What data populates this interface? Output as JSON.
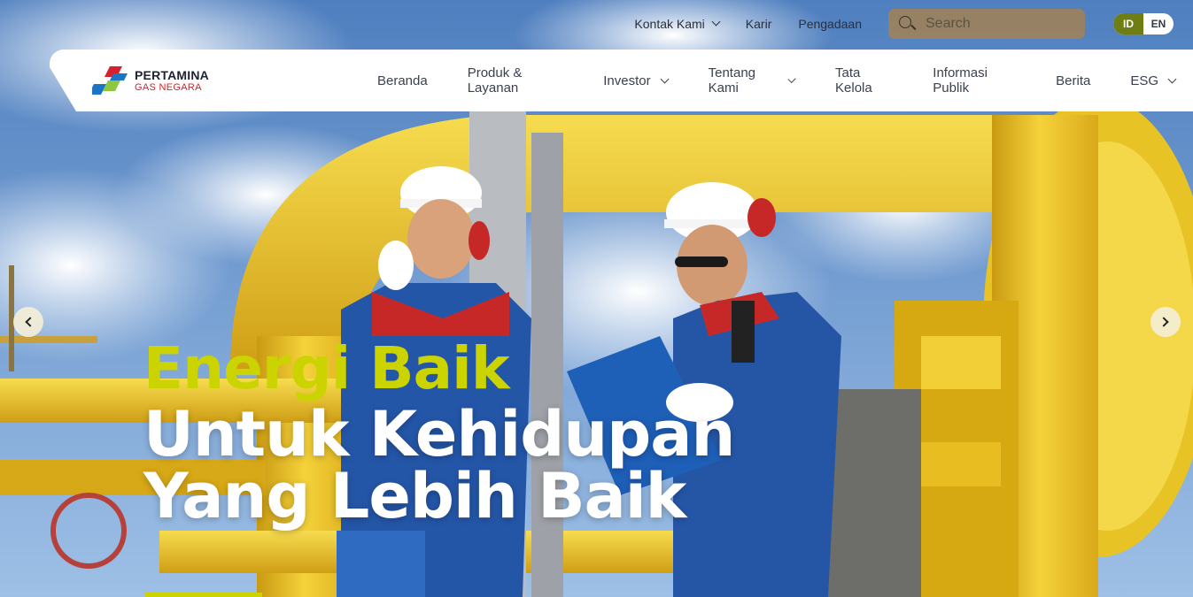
{
  "topbar": {
    "links": [
      {
        "label": "Kontak Kami",
        "has_dropdown": true
      },
      {
        "label": "Karir",
        "has_dropdown": false
      },
      {
        "label": "Pengadaan",
        "has_dropdown": false
      }
    ],
    "search_placeholder": "Search",
    "lang_active": "ID",
    "lang_inactive": "EN"
  },
  "brand": {
    "name": "PERTAMINA",
    "subname": "GAS NEGARA"
  },
  "nav": {
    "items": [
      {
        "label": "Beranda",
        "has_dropdown": false
      },
      {
        "label": "Produk & Layanan",
        "has_dropdown": false
      },
      {
        "label": "Investor",
        "has_dropdown": true
      },
      {
        "label": "Tentang Kami",
        "has_dropdown": true
      },
      {
        "label": "Tata Kelola",
        "has_dropdown": false
      },
      {
        "label": "Informasi Publik",
        "has_dropdown": false
      },
      {
        "label": "Berita",
        "has_dropdown": false
      },
      {
        "label": "ESG",
        "has_dropdown": true
      }
    ]
  },
  "hero": {
    "line1": "Energi Baik",
    "line2": "Untuk Kehidupan",
    "line3": "Yang Lebih Baik"
  },
  "colors": {
    "accent_lime": "#cbd400",
    "lang_active_bg": "#6f7e14",
    "brand_red": "#d6202d",
    "brand_blue": "#1c74c4",
    "brand_green": "#8dc63f"
  },
  "icons": [
    "search-icon",
    "chevron-down-icon",
    "arrow-left-icon",
    "arrow-right-icon"
  ]
}
